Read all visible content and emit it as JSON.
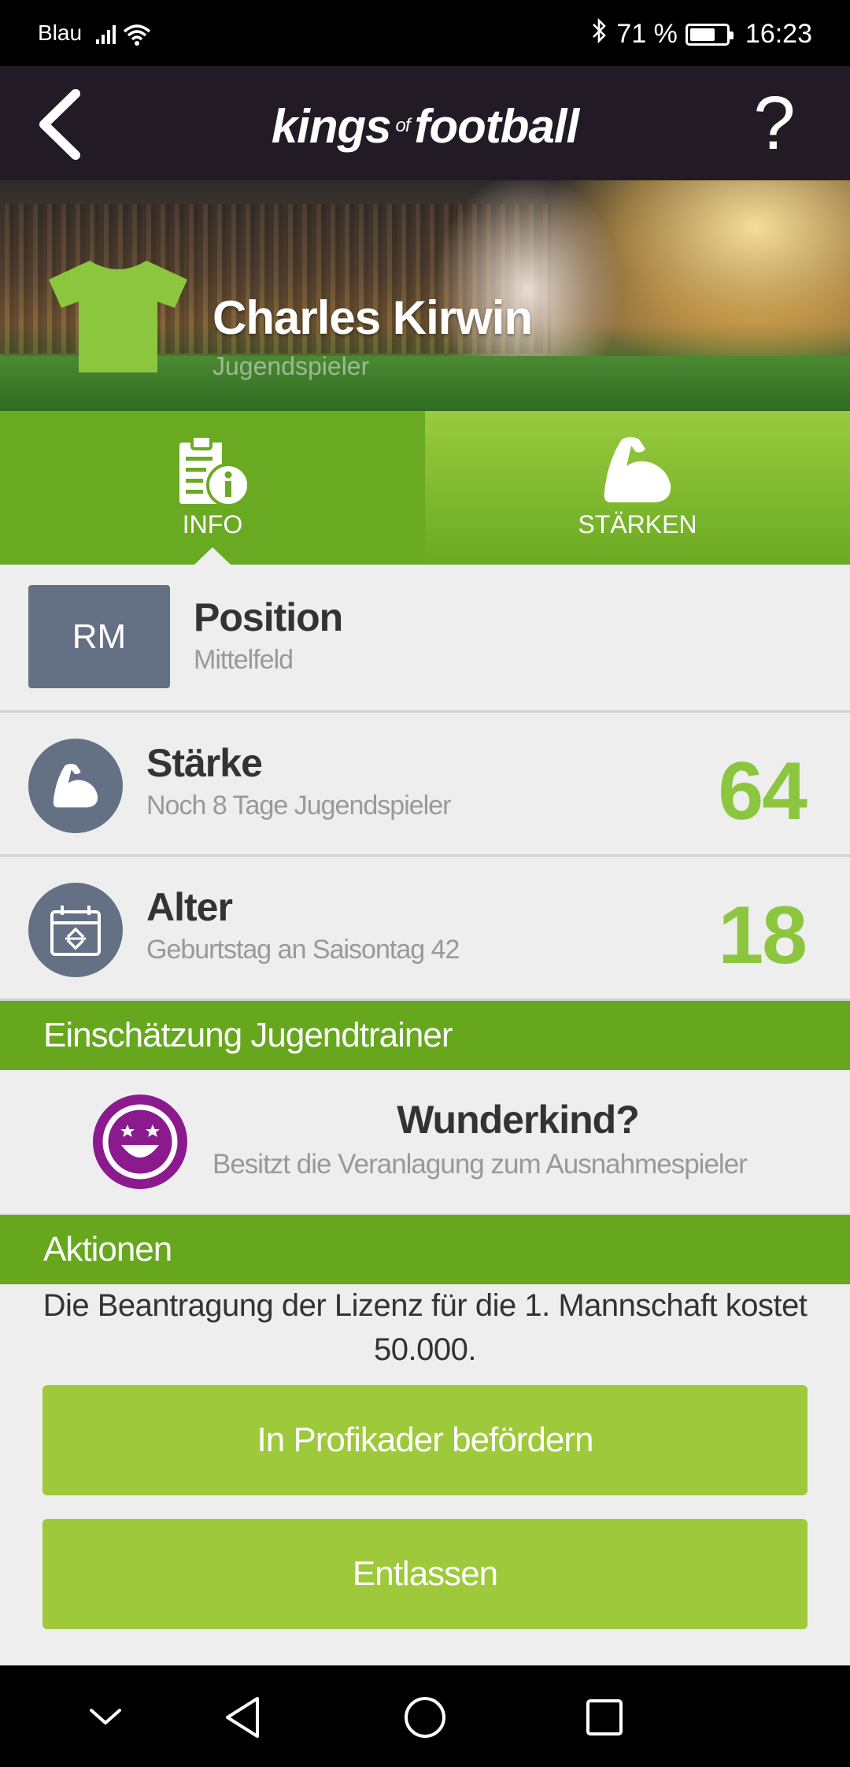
{
  "status_bar": {
    "carrier": "Blau",
    "battery": "71 %",
    "battery_level": 0.71,
    "time": "16:23"
  },
  "header": {
    "logo_main_1": "kings",
    "logo_of": "of",
    "logo_main_2": "football",
    "help_label": "?"
  },
  "player": {
    "name": "Charles Kirwin",
    "role": "Jugendspieler",
    "shirt_color": "#8cc63e"
  },
  "tabs": [
    {
      "label": "INFO",
      "icon": "info-document-icon",
      "active": true
    },
    {
      "label": "STÄRKEN",
      "icon": "flexed-arm-icon",
      "active": false
    }
  ],
  "info": {
    "position": {
      "badge": "RM",
      "title": "Position",
      "subtitle": "Mittelfeld"
    },
    "strength": {
      "title": "Stärke",
      "subtitle": "Noch 8 Tage Jugendspieler",
      "value": "64"
    },
    "age": {
      "title": "Alter",
      "subtitle": "Geburtstag an Saisontag 42",
      "value": "18"
    }
  },
  "assessment": {
    "header": "Einschätzung Jugendtrainer",
    "title": "Wunderkind?",
    "subtitle": "Besitzt die Veranlagung zum Ausnahmespieler",
    "icon_color": "#8b1a8f"
  },
  "actions": {
    "header": "Aktionen",
    "description": "Die Beantragung der Lizenz für die 1. Mannschaft kostet 50.000.",
    "promote_label": "In Profikader befördern",
    "dismiss_label": "Entlassen"
  },
  "colors": {
    "accent_green": "#66a71e",
    "button_green": "#9ec93b",
    "value_green": "#8cc63e",
    "badge_gray": "#647084",
    "header_dark": "#221b26"
  }
}
